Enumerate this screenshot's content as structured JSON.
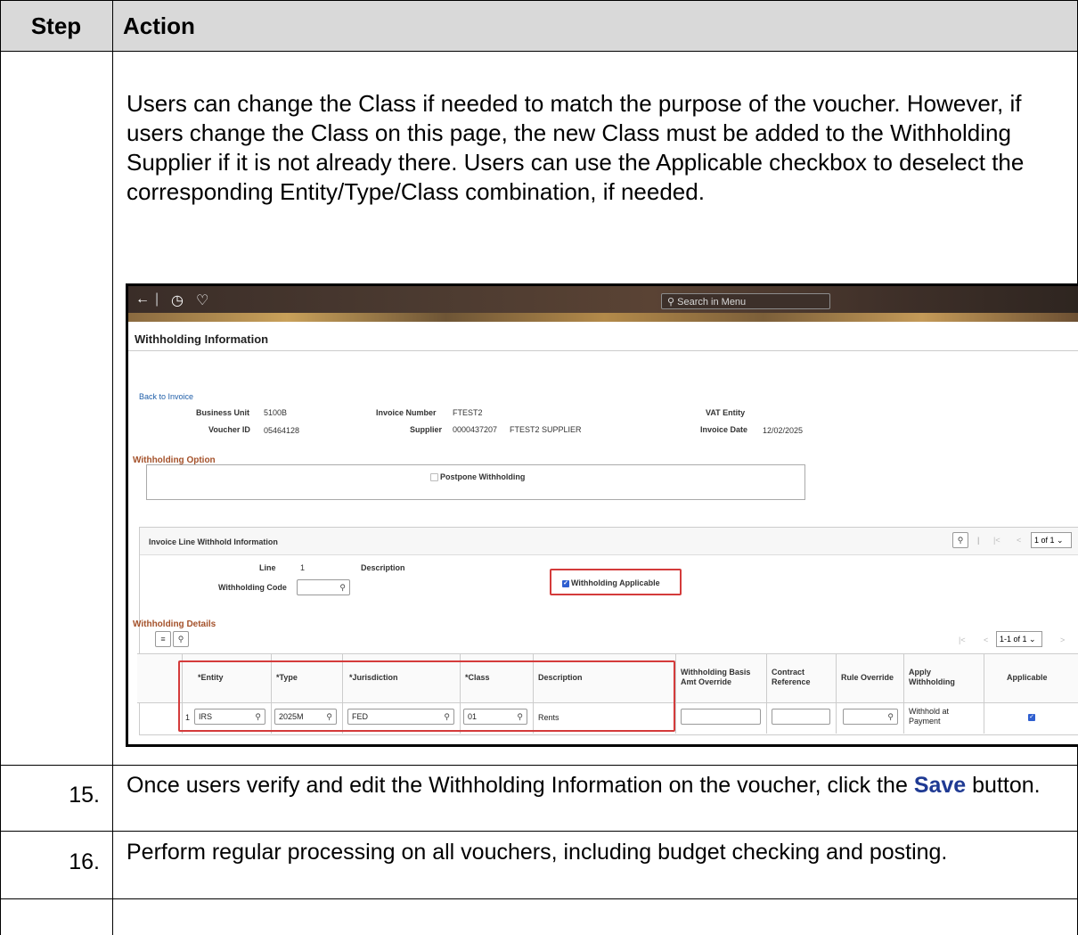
{
  "table": {
    "header_step": "Step",
    "header_action": "Action",
    "intro_paragraph": "Users can change the Class if needed to match the purpose of the voucher. However, if users change the Class on this page, the new Class must be added to the Withholding Supplier if it is not already there. Users can use the Applicable checkbox to deselect the corresponding Entity/Type/Class combination, if needed.",
    "rows": [
      {
        "step": "15.",
        "text_before": "Once users verify and edit the Withholding Information on the voucher, click the ",
        "emphasis": "Save",
        "text_after": " button."
      },
      {
        "step": "16.",
        "text": "Perform regular processing on all vouchers, including budget checking and posting."
      }
    ]
  },
  "screenshot": {
    "search_placeholder": "Search in Menu",
    "page_title": "Withholding Information",
    "back_link": "Back to Invoice",
    "header_fields": {
      "business_unit_label": "Business Unit",
      "business_unit_value": "5100B",
      "voucher_id_label": "Voucher ID",
      "voucher_id_value": "05464128",
      "invoice_number_label": "Invoice Number",
      "invoice_number_value": "FTEST2",
      "supplier_label": "Supplier",
      "supplier_value": "0000437207",
      "supplier_name": "FTEST2 SUPPLIER",
      "vat_entity_label": "VAT Entity",
      "invoice_date_label": "Invoice Date",
      "invoice_date_value": "12/02/2025"
    },
    "withholding_option": {
      "section_title": "Withholding Option",
      "postpone_label": "Postpone Withholding"
    },
    "invoice_line": {
      "section_title": "Invoice Line Withhold Information",
      "pager": "1 of 1",
      "line_label": "Line",
      "line_value": "1",
      "description_label": "Description",
      "withholding_code_label": "Withholding Code",
      "withholding_applicable_label": "Withholding Applicable"
    },
    "details": {
      "section_title": "Withholding Details",
      "pager": "1-1 of 1",
      "columns": [
        "*Entity",
        "*Type",
        "*Jurisdiction",
        "*Class",
        "Description",
        "Withholding Basis Amt Override",
        "Contract Reference",
        "Rule Override",
        "Apply Withholding",
        "Applicable"
      ],
      "row": {
        "num": "1",
        "entity": "IRS",
        "type": "2025M",
        "jurisdiction": "FED",
        "class": "01",
        "description": "Rents",
        "apply_withholding": "Withhold at Payment"
      }
    }
  }
}
